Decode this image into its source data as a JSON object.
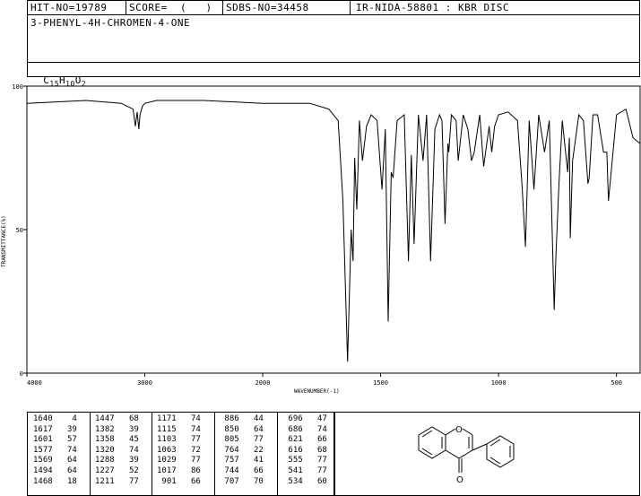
{
  "header": {
    "hit_no": "HIT-NO=19789",
    "score": "SCORE=  (   )",
    "sdbs_no": "SDBS-NO=34458",
    "ir_info": "IR-NIDA-58801 : KBR DISC",
    "compound_name": "3-PHENYL-4H-CHROMEN-4-ONE",
    "formula": {
      "c": "C",
      "c_n": "15",
      "h": "H",
      "h_n": "10",
      "o": "O",
      "o_n": "2"
    }
  },
  "chart_data": {
    "type": "line",
    "xlabel": "WAVENUMBER(-1)",
    "ylabel": "TRANSMITTANCE(%)",
    "xlim": [
      4000,
      400
    ],
    "ylim": [
      0,
      100
    ],
    "x_ticks": [
      "4000",
      "3000",
      "2000",
      "1500",
      "1000",
      "500"
    ],
    "y_ticks": [
      "100",
      "50",
      "0"
    ],
    "x": [
      4000,
      3500,
      3200,
      3100,
      3080,
      3065,
      3050,
      3040,
      3020,
      3000,
      2900,
      2500,
      2000,
      1800,
      1720,
      1680,
      1660,
      1640,
      1625,
      1617,
      1610,
      1601,
      1590,
      1577,
      1560,
      1540,
      1515,
      1494,
      1480,
      1468,
      1455,
      1447,
      1430,
      1400,
      1382,
      1370,
      1358,
      1340,
      1320,
      1305,
      1288,
      1270,
      1250,
      1240,
      1227,
      1215,
      1211,
      1200,
      1180,
      1171,
      1150,
      1130,
      1115,
      1103,
      1080,
      1063,
      1040,
      1029,
      1017,
      1000,
      960,
      920,
      901,
      886,
      870,
      850,
      830,
      805,
      785,
      764,
      757,
      744,
      730,
      707,
      700,
      696,
      686,
      660,
      640,
      621,
      616,
      600,
      580,
      555,
      541,
      534,
      500,
      460,
      430,
      400
    ],
    "y": [
      94,
      95,
      94,
      92,
      86,
      91,
      85,
      90,
      93,
      94,
      95,
      95,
      94,
      94,
      92,
      88,
      60,
      4,
      50,
      39,
      75,
      57,
      88,
      74,
      86,
      90,
      88,
      64,
      85,
      18,
      70,
      68,
      88,
      90,
      39,
      76,
      45,
      90,
      74,
      90,
      39,
      85,
      90,
      88,
      52,
      80,
      77,
      90,
      88,
      74,
      90,
      85,
      74,
      77,
      90,
      72,
      86,
      77,
      86,
      90,
      91,
      88,
      66,
      44,
      88,
      64,
      90,
      77,
      88,
      22,
      41,
      66,
      88,
      70,
      82,
      47,
      74,
      90,
      88,
      66,
      68,
      90,
      90,
      77,
      77,
      60,
      90,
      92,
      82,
      80
    ],
    "peaks": [
      {
        "wavenumber": "1640",
        "t": "4"
      },
      {
        "wavenumber": "1617",
        "t": "39"
      },
      {
        "wavenumber": "1601",
        "t": "57"
      },
      {
        "wavenumber": "1577",
        "t": "74"
      },
      {
        "wavenumber": "1569",
        "t": "64"
      },
      {
        "wavenumber": "1494",
        "t": "64"
      },
      {
        "wavenumber": "1468",
        "t": "18"
      },
      {
        "wavenumber": "1447",
        "t": "68"
      },
      {
        "wavenumber": "1382",
        "t": "39"
      },
      {
        "wavenumber": "1358",
        "t": "45"
      },
      {
        "wavenumber": "1320",
        "t": "74"
      },
      {
        "wavenumber": "1288",
        "t": "39"
      },
      {
        "wavenumber": "1227",
        "t": "52"
      },
      {
        "wavenumber": "1211",
        "t": "77"
      },
      {
        "wavenumber": "1171",
        "t": "74"
      },
      {
        "wavenumber": "1115",
        "t": "74"
      },
      {
        "wavenumber": "1103",
        "t": "77"
      },
      {
        "wavenumber": "1063",
        "t": "72"
      },
      {
        "wavenumber": "1029",
        "t": "77"
      },
      {
        "wavenumber": "1017",
        "t": "86"
      },
      {
        "wavenumber": "901",
        "t": "66"
      },
      {
        "wavenumber": "886",
        "t": "44"
      },
      {
        "wavenumber": "850",
        "t": "64"
      },
      {
        "wavenumber": "805",
        "t": "77"
      },
      {
        "wavenumber": "764",
        "t": "22"
      },
      {
        "wavenumber": "757",
        "t": "41"
      },
      {
        "wavenumber": "744",
        "t": "66"
      },
      {
        "wavenumber": "707",
        "t": "70"
      },
      {
        "wavenumber": "696",
        "t": "47"
      },
      {
        "wavenumber": "686",
        "t": "74"
      },
      {
        "wavenumber": "621",
        "t": "66"
      },
      {
        "wavenumber": "616",
        "t": "68"
      },
      {
        "wavenumber": "555",
        "t": "77"
      },
      {
        "wavenumber": "541",
        "t": "77"
      },
      {
        "wavenumber": "534",
        "t": "60"
      }
    ]
  },
  "structure": {
    "carbonyl_label": "O",
    "ring_oxygen_label": "O"
  },
  "colors": {
    "line": "#000000",
    "background": "#ffffff"
  }
}
